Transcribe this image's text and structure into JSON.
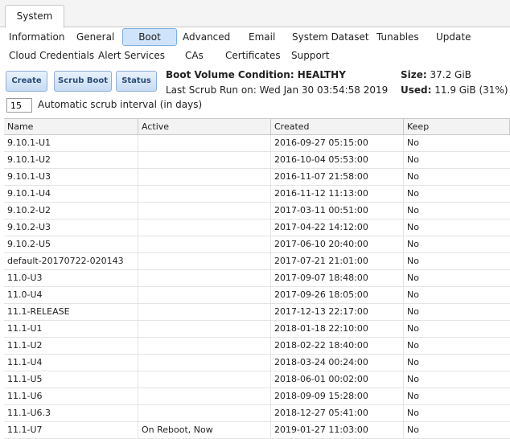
{
  "main_tab": "System",
  "subtabs_row1": [
    "Information",
    "General",
    "Boot",
    "Advanced",
    "Email",
    "System Dataset",
    "Tunables",
    "Update"
  ],
  "subtabs_row2": [
    "Cloud Credentials",
    "Alert Services",
    "CAs",
    "Certificates",
    "Support"
  ],
  "toolbar": {
    "create": "Create",
    "scrub_boot": "Scrub Boot",
    "status": "Status"
  },
  "status": {
    "condition": "Boot Volume Condition: HEALTHY",
    "last_scrub": "Last Scrub Run on: Wed Jan 30 03:54:58 2019",
    "size_label": "Size:",
    "size_value": "37.2 GiB",
    "used_label": "Used:",
    "used_value": "11.9 GiB (31%)"
  },
  "scrub_interval": {
    "value": "15",
    "label": "Automatic scrub interval (in days)"
  },
  "table": {
    "headers": [
      "Name",
      "Active",
      "Created",
      "Keep"
    ],
    "rows": [
      [
        "9.10.1-U1",
        "",
        "2016-09-27 05:15:00",
        "No"
      ],
      [
        "9.10.1-U2",
        "",
        "2016-10-04 05:53:00",
        "No"
      ],
      [
        "9.10.1-U3",
        "",
        "2016-11-07 21:58:00",
        "No"
      ],
      [
        "9.10.1-U4",
        "",
        "2016-11-12 11:13:00",
        "No"
      ],
      [
        "9.10.2-U2",
        "",
        "2017-03-11 00:51:00",
        "No"
      ],
      [
        "9.10.2-U3",
        "",
        "2017-04-22 14:12:00",
        "No"
      ],
      [
        "9.10.2-U5",
        "",
        "2017-06-10 20:40:00",
        "No"
      ],
      [
        "default-20170722-020143",
        "",
        "2017-07-21 21:01:00",
        "No"
      ],
      [
        "11.0-U3",
        "",
        "2017-09-07 18:48:00",
        "No"
      ],
      [
        "11.0-U4",
        "",
        "2017-09-26 18:05:00",
        "No"
      ],
      [
        "11.1-RELEASE",
        "",
        "2017-12-13 22:17:00",
        "No"
      ],
      [
        "11.1-U1",
        "",
        "2018-01-18 22:10:00",
        "No"
      ],
      [
        "11.1-U2",
        "",
        "2018-02-22 18:40:00",
        "No"
      ],
      [
        "11.1-U4",
        "",
        "2018-03-24 00:24:00",
        "No"
      ],
      [
        "11.1-U5",
        "",
        "2018-06-01 00:02:00",
        "No"
      ],
      [
        "11.1-U6",
        "",
        "2018-09-09 15:28:00",
        "No"
      ],
      [
        "11.1-U6.3",
        "",
        "2018-12-27 05:41:00",
        "No"
      ],
      [
        "11.1-U7",
        "On Reboot, Now",
        "2019-01-27 11:03:00",
        "No"
      ]
    ]
  }
}
